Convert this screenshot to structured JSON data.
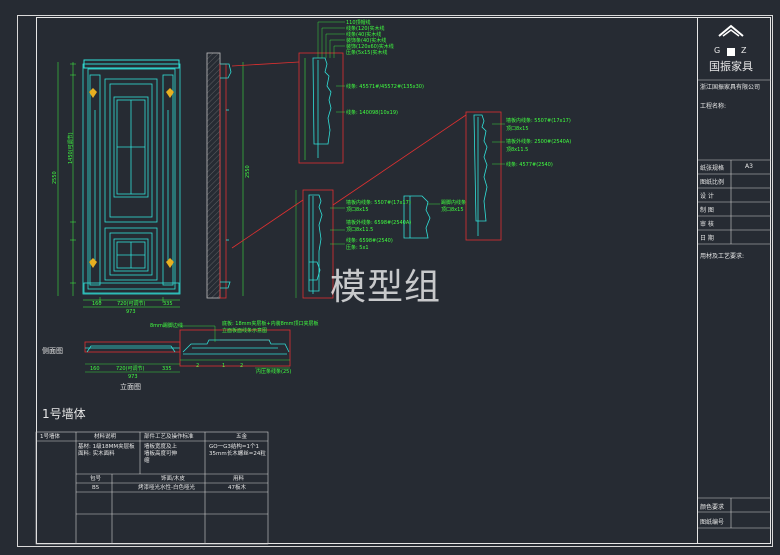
{
  "watermark": "模型组",
  "logo": {
    "letters_top": "G",
    "letters_top2": "Z",
    "brand": "国振家具",
    "company": "浙江国振家具有限公司"
  },
  "title_block": {
    "project_name_label": "工程名称:",
    "sheet_size_label": "纸张规格",
    "sheet_size_value": "A3",
    "scale_label": "图纸比例",
    "design_label": "设  计",
    "drawing_label": "制  图",
    "review_label": "审  核",
    "date_label": "日  期",
    "materials_label": "用材及工艺要求:",
    "color_req_label": "颜色要求",
    "drawing_no_label": "图纸编号"
  },
  "section_title": "1号墙体",
  "views": {
    "side_view": "侧面图",
    "plan_view": "立面图"
  },
  "dimensions": {
    "total_height": "2550",
    "bottom_widths": [
      "160",
      "720(可调节)",
      "335"
    ],
    "total_width": "973",
    "plan_widths": [
      "160",
      "720(可调节)",
      "335"
    ],
    "plan_total": "973",
    "side_height": "2550"
  },
  "annotations": {
    "top_detail": [
      "110顶帽线",
      "线条(120)实木线",
      "线条(40)实木线",
      "装饰条(40)实木线",
      "装饰(120x60)实木线",
      "压条(5x15)实木线"
    ],
    "top_detail_2": [
      "线条: 45571#/45572#(135x30)",
      "线条: 140098(10x19)"
    ],
    "right_detail": [
      "墙板内线条: 5507#(17x17)",
      "顶口8x15",
      "墙板外线条: 2500#(2540A)",
      "顶8x11.5",
      "线条: 4577#(2540)"
    ],
    "mid_detail": [
      "墙板内线条: 5507#(17x17)",
      "顶口8x15",
      "墙板外线条: 6598#(2540A)",
      "顶口8x11.5",
      "线条: 6598#(2540)",
      "压条: 5x1"
    ],
    "mid_detail_right": [
      "踢脚内线条",
      "顶口8x15"
    ],
    "plan_detail": [
      "8mm踢脚边线",
      "底板: 18mm夹层板+内装8mm顶口夹层板",
      "立面板面线条示意图"
    ],
    "plan_detail_2": [
      "内压条线条(25)"
    ],
    "plan_numbers": [
      "2",
      "1",
      "2"
    ]
  },
  "table": {
    "header": [
      "1号墙体",
      "材料说明",
      "部件工艺及操作标准",
      "五金"
    ],
    "row1": [
      "基材: 1级18MM夹层板\n面料: 实木面料",
      "墙板宽度及上\n墙板高度可伸\n缩",
      "GO一G3结构=1个1\n35mm长木螺丝=24粒"
    ],
    "header2": [
      "包号",
      "饰面/木皮",
      "用料"
    ],
    "row2": [
      "B5",
      "烤漆哑光水性-白色哑光",
      "47板木"
    ]
  },
  "colors": {
    "line": "#30e0d8",
    "annotation": "#40ff40",
    "frame": "#e6e6e6",
    "red": "#e03030",
    "gold": "#e8b020"
  }
}
